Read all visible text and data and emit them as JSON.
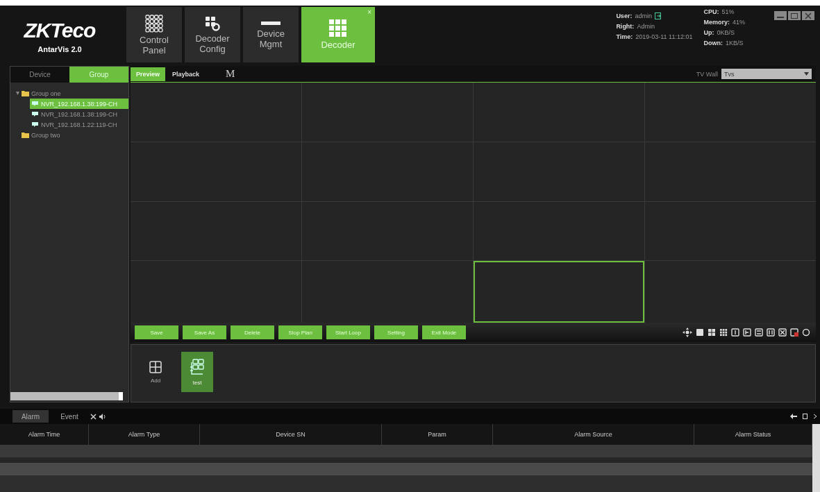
{
  "header": {
    "logo": "ZKTeco",
    "product": "AntarVis 2.0",
    "tabs": [
      {
        "kind": "grid",
        "label": "Control Panel",
        "selected": false
      },
      {
        "kind": "config",
        "label": "Decoder Config",
        "selected": false
      },
      {
        "kind": "bar",
        "label": "Device Mgmt",
        "selected": false
      },
      {
        "kind": "blocks",
        "label": "Decoder",
        "selected": true,
        "close": "×"
      }
    ],
    "user": [
      {
        "key": "User:",
        "value": "admin"
      },
      {
        "key": "Right:",
        "value": "Admin"
      },
      {
        "key": "Time:",
        "value": "2019-03-11 11:12:01"
      }
    ],
    "stats": [
      {
        "key": "CPU:",
        "value": "51%"
      },
      {
        "key": "Memory:",
        "value": "41%"
      },
      {
        "key": "Up:",
        "value": "0KB/S"
      },
      {
        "key": "Down:",
        "value": "1KB/S"
      }
    ]
  },
  "sidebar": {
    "tabs": [
      {
        "label": "Device",
        "selected": false
      },
      {
        "label": "Group",
        "selected": true
      }
    ],
    "tree": [
      {
        "label": "Group one",
        "expanded": true,
        "children": [
          {
            "label": "NVR_192.168.1.38:199-CH",
            "selected": true
          },
          {
            "label": "NVR_192.168.1.38:199-CH",
            "selected": false
          },
          {
            "label": "NVR_192.168.1.22:119-CH",
            "selected": false
          }
        ]
      },
      {
        "label": "Group two",
        "expanded": false
      }
    ]
  },
  "view_tabs": [
    {
      "label": "Preview",
      "selected": true
    },
    {
      "label": "Playback",
      "selected": false
    },
    {
      "label": "M",
      "selected": false
    }
  ],
  "tv_wall": {
    "label": "TV Wall",
    "value": "Tvs"
  },
  "wall": {
    "cells": [
      {
        "selected": false
      },
      {
        "selected": false
      },
      {
        "selected": false
      },
      {
        "selected": false
      },
      {
        "selected": false
      },
      {
        "selected": false
      },
      {
        "selected": false
      },
      {
        "selected": false
      },
      {
        "selected": false
      },
      {
        "selected": false
      },
      {
        "selected": false
      },
      {
        "selected": false
      },
      {
        "selected": false
      },
      {
        "selected": false
      },
      {
        "selected": true
      },
      {
        "selected": false
      }
    ]
  },
  "actions": [
    "Save",
    "Save As",
    "Delete",
    "Stop Plan",
    "Start Loop",
    "Setting",
    "Exit Mode"
  ],
  "modes": [
    {
      "kind": "quad",
      "label": "Add",
      "selected": false
    },
    {
      "kind": "multi",
      "label": "test",
      "selected": true
    }
  ],
  "alarm": {
    "tabs": [
      {
        "label": "Alarm",
        "selected": true
      },
      {
        "label": "Event",
        "selected": false
      }
    ],
    "columns": [
      "Alarm Time",
      "Alarm Type",
      "Device SN",
      "Param",
      "Alarm Source",
      "Alarm Status"
    ]
  }
}
